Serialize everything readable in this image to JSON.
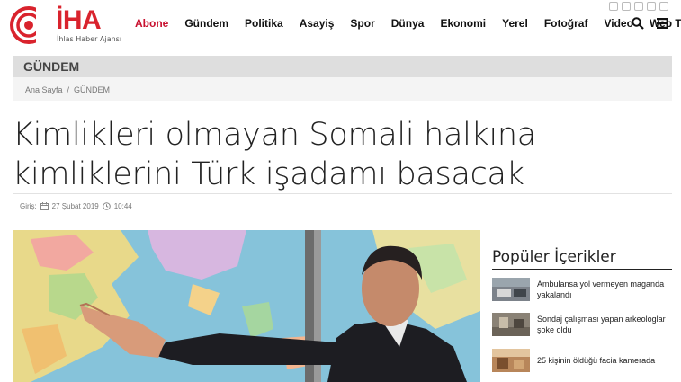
{
  "logo": {
    "text": "İHA",
    "subtitle": "İhlas Haber Ajansı"
  },
  "nav": {
    "items": [
      "Abone",
      "Gündem",
      "Politika",
      "Asayiş",
      "Spor",
      "Dünya",
      "Ekonomi",
      "Yerel",
      "Fotoğraf",
      "Video",
      "Web TV"
    ],
    "active_index": 0
  },
  "colors": {
    "brand": "#d9232d",
    "active_nav": "#c8102e"
  },
  "category": {
    "title": "GÜNDEM",
    "breadcrumb": [
      "Ana Sayfa",
      "/",
      "GÜNDEM"
    ]
  },
  "article": {
    "title": "Kimlikleri olmayan Somali halkına kimliklerini Türk işadamı basacak",
    "meta": {
      "label": "Giriş:",
      "date": "27 Şubat 2019",
      "time": "10:44"
    }
  },
  "sidebar": {
    "title": "Popüler İçerikler",
    "items": [
      {
        "text": "Ambulansa yol vermeyen maganda yakalandı"
      },
      {
        "text": "Sondaj çalışması yapan arkeologlar şoke oldu"
      },
      {
        "text": "25 kişinin öldüğü facia kamerada"
      }
    ]
  },
  "icons": [
    "facebook-icon",
    "twitter-icon",
    "youtube-icon",
    "instagram-icon",
    "rss-icon",
    "search-icon",
    "menu-icon",
    "calendar-icon",
    "clock-icon"
  ]
}
